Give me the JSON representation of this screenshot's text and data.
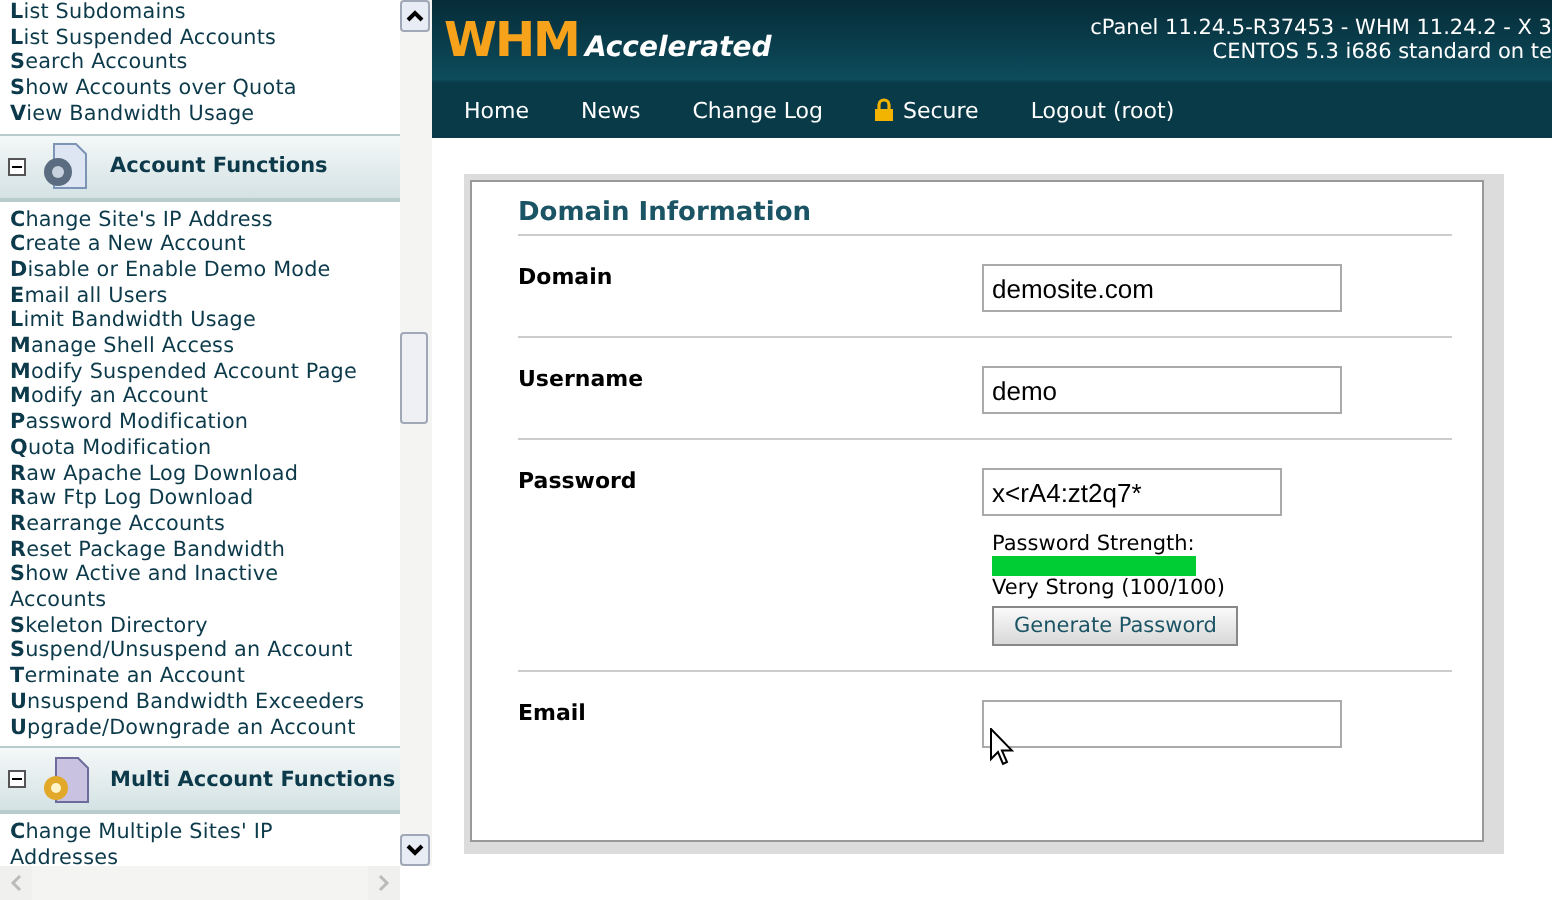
{
  "sidebar": {
    "groups": [
      {
        "items": [
          "**L**ist Subdomains",
          "**L**ist Suspended Accounts",
          "**S**earch Accounts",
          "**S**how Accounts over Quota",
          "**V**iew Bandwidth Usage"
        ]
      },
      {
        "title": "Account Functions",
        "expanded": true,
        "items": [
          "**C**hange Site's IP Address",
          "**C**reate a New Account",
          "**D**isable or Enable Demo Mode",
          "**E**mail all Users",
          "**L**imit Bandwidth Usage",
          "**M**anage Shell Access",
          "**M**odify Suspended Account Page",
          "**M**odify an Account",
          "**P**assword Modification",
          "**Q**uota Modification",
          "**R**aw Apache Log Download",
          "**R**aw Ftp Log Download",
          "**R**earrange Accounts",
          "**R**eset Package Bandwidth",
          "**S**how Active and Inactive Accounts",
          "**S**keleton Directory",
          "**S**uspend/Unsuspend an Account",
          "**T**erminate an Account",
          "**U**nsuspend Bandwidth Exceeders",
          "**U**pgrade/Downgrade an Account"
        ]
      },
      {
        "title": "Multi Account Functions",
        "expanded": true,
        "items": [
          "**C**hange Multiple Sites' IP Addresses"
        ]
      }
    ]
  },
  "header": {
    "logo_main": "WHM",
    "logo_sub": "Accelerated",
    "version_lines": [
      "cPanel 11.24.5-R37453 - WHM 11.24.2 - X 3",
      "CENTOS 5.3 i686 standard on te"
    ]
  },
  "nav": [
    {
      "label": "Home",
      "kind": "link"
    },
    {
      "label": "News",
      "kind": "link"
    },
    {
      "label": "Change Log",
      "kind": "link"
    },
    {
      "label": "Secure",
      "kind": "lock"
    },
    {
      "label": "Logout (root)",
      "kind": "link"
    }
  ],
  "form": {
    "title": "Domain Information",
    "fields": [
      {
        "label": "Domain",
        "value": "demosite.com",
        "kind": "text"
      },
      {
        "label": "Username",
        "value": "demo",
        "kind": "text"
      },
      {
        "label": "Password",
        "value": "x<rA4:zt2q7*",
        "kind": "password",
        "strength_label": "Password Strength:",
        "level": 1,
        "strength_text": "Very Strong (100/100)",
        "button": "Generate Password"
      },
      {
        "label": "Email",
        "kind": "text"
      }
    ]
  }
}
